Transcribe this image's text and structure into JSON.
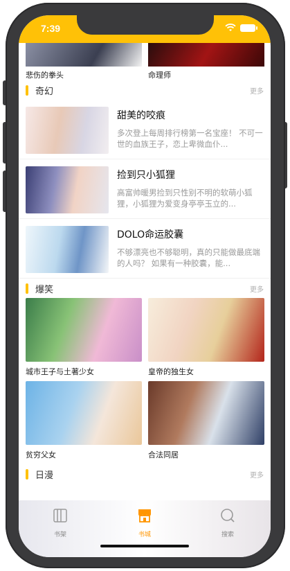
{
  "status": {
    "time": "7:39"
  },
  "top_row": {
    "left_label": "悲伤的拳头",
    "right_label": "命理师"
  },
  "sections": {
    "fantasy": {
      "title": "奇幻",
      "more": "更多"
    },
    "funny": {
      "title": "爆笑",
      "more": "更多"
    },
    "japan": {
      "title": "日漫",
      "more": "更多"
    }
  },
  "fantasy_list": [
    {
      "title": "甜美的咬痕",
      "desc": "多次登上每周排行榜第一名宝座！ 不可一世的血族王子，恋上卑微血仆..."
    },
    {
      "title": "捡到只小狐狸",
      "desc": "高富帅暖男捡到只性别不明的软萌小狐狸，小狐狸为爱变身亭亭玉立的..."
    },
    {
      "title": "DOLO命运胶囊",
      "desc": "不够漂亮也不够聪明，真的只能做最底端的人吗？ 如果有一种胶囊，能..."
    }
  ],
  "funny_grid": [
    {
      "label": "城市王子与土著少女"
    },
    {
      "label": "皇帝的独生女"
    },
    {
      "label": "贫穷父女"
    },
    {
      "label": "合法同居"
    }
  ],
  "tabs": [
    {
      "label": "书架",
      "icon": "shelf-icon"
    },
    {
      "label": "书城",
      "icon": "store-icon"
    },
    {
      "label": "搜索",
      "icon": "search-icon"
    }
  ],
  "colors": {
    "accent": "#ffc107",
    "active_tab": "#ff9500"
  }
}
